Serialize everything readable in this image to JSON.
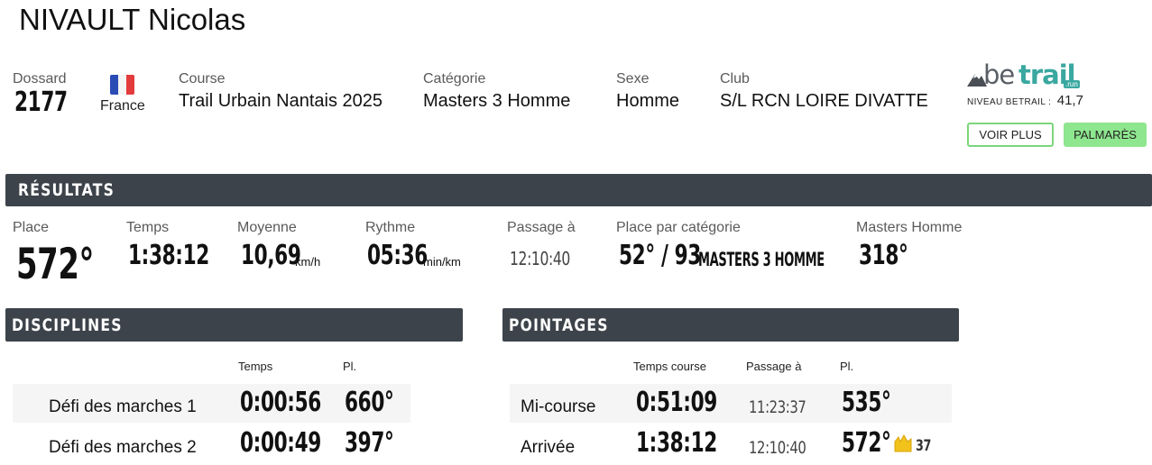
{
  "athlete": {
    "name": "NIVAULT Nicolas"
  },
  "info": {
    "dossard_label": "Dossard",
    "dossard": "2177",
    "country": "France",
    "course_label": "Course",
    "course": "Trail Urbain Nantais 2025",
    "categorie_label": "Catégorie",
    "categorie": "Masters 3 Homme",
    "sexe_label": "Sexe",
    "sexe": "Homme",
    "club_label": "Club",
    "club": "S/L RCN LOIRE DIVATTE"
  },
  "brand": {
    "logo_text_1": "be",
    "logo_text_2": "trail",
    "logo_badge": ".run",
    "niveau_label": "NIVEAU BETRAIL :",
    "niveau_value": "41,7",
    "voir_plus": "VOIR PLUS",
    "palmares": "PALMARÈS"
  },
  "colors": {
    "bar": "#3d434a",
    "green_button": "#8ee68e",
    "outline_button": "#7bd67b",
    "brand_teal": "#3aa8a0",
    "flag_blue": "#2a4cb5",
    "flag_red": "#e33b3b",
    "medal": "#f1c21b"
  },
  "results": {
    "title": "RÉSULTATS",
    "place_label": "Place",
    "place": "572°",
    "temps_label": "Temps",
    "temps": "1:38:12",
    "moyenne_label": "Moyenne",
    "moyenne": "10,69",
    "moyenne_unit": "km/h",
    "rythme_label": "Rythme",
    "rythme": "05:36",
    "rythme_unit": "min/km",
    "passage_label": "Passage à",
    "passage": "12:10:40",
    "place_cat_label": "Place par catégorie",
    "place_cat": "52° / 93",
    "place_cat_name": "MASTERS 3 HOMME",
    "masters_label": "Masters Homme",
    "masters": "318°"
  },
  "disciplines": {
    "title": "DISCIPLINES",
    "col_temps": "Temps",
    "col_pl": "Pl.",
    "rows": [
      {
        "name": "Défi des marches 1",
        "temps": "0:00:56",
        "pl": "660°"
      },
      {
        "name": "Défi des marches 2",
        "temps": "0:00:49",
        "pl": "397°"
      }
    ]
  },
  "pointages": {
    "title": "POINTAGES",
    "col_temps": "Temps course",
    "col_passage": "Passage à",
    "col_pl": "Pl.",
    "rows": [
      {
        "name": "Mi-course",
        "temps": "0:51:09",
        "passage": "11:23:37",
        "pl": "535°"
      },
      {
        "name": "Arrivée",
        "temps": "1:38:12",
        "passage": "12:10:40",
        "pl": "572°",
        "badge_icon": "medal-icon",
        "badge": "37"
      }
    ]
  }
}
